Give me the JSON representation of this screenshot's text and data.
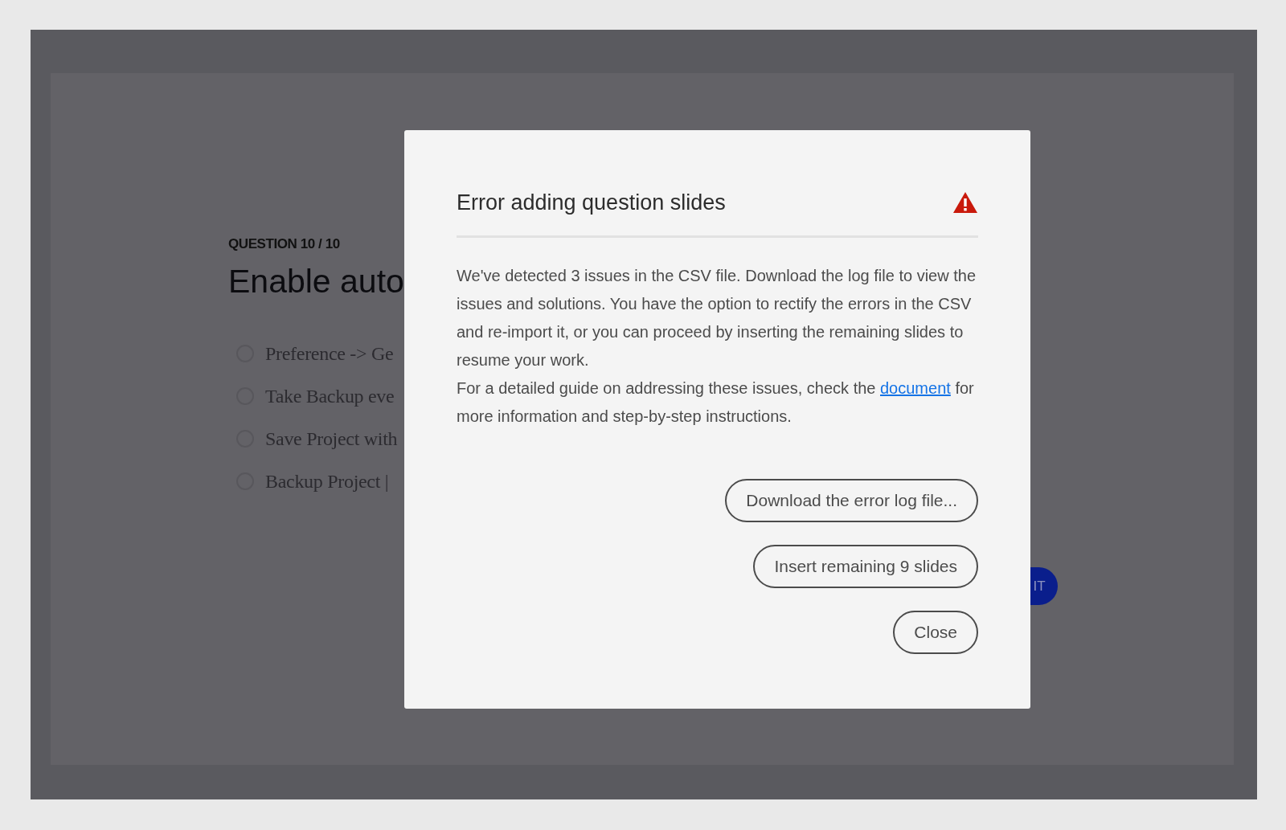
{
  "slide": {
    "question_label": "QUESTION 10 / 10",
    "question_title": "Enable auto",
    "options": [
      {
        "label": "Preference -> Ge",
        "selected": false
      },
      {
        "label": "Take Backup eve",
        "selected": false
      },
      {
        "label": "Save Project with",
        "selected": false
      },
      {
        "label": "Backup Project |",
        "selected": false
      }
    ],
    "submit_button": "IT"
  },
  "dialog": {
    "title": "Error adding question slides",
    "message": "We've detected 3 issues in the CSV file. Download the log file to view the issues and solutions. You have the option to rectify the errors in the CSV and re-import it, or you can proceed by inserting the remaining slides to resume your work.",
    "guide_text": "For a detailed guide on addressing these issues, check the",
    "guide_link": "document",
    "guide_tail": "for more information and step-by-step instructions.",
    "buttons": [
      "Download the error log file...",
      "Insert remaining 9 slides",
      "Close"
    ]
  }
}
